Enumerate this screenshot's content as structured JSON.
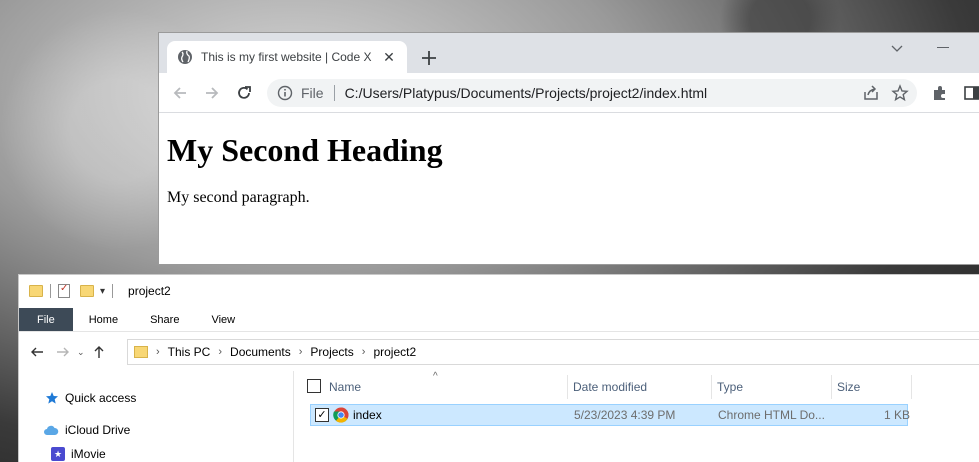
{
  "browser": {
    "tab_title": "This is my first website | Code X",
    "url_scheme": "File",
    "url": "C:/Users/Platypus/Documents/Projects/project2/index.html",
    "page": {
      "heading": "My Second Heading",
      "paragraph": "My second paragraph."
    }
  },
  "explorer": {
    "title": "project2",
    "ribbon_tabs": [
      "File",
      "Home",
      "Share",
      "View"
    ],
    "breadcrumb": [
      "This PC",
      "Documents",
      "Projects",
      "project2"
    ],
    "nav_items": [
      "Quick access",
      "iCloud Drive",
      "iMovie"
    ],
    "columns": [
      "Name",
      "Date modified",
      "Type",
      "Size"
    ],
    "files": [
      {
        "name": "index",
        "date_modified": "5/23/2023 4:39 PM",
        "type": "Chrome HTML Do...",
        "size": "1 KB",
        "selected": true
      }
    ]
  },
  "colors": {
    "selection": "#cce8ff",
    "ribbon_file_tab": "#3d4a57",
    "folder": "#f8d775"
  }
}
